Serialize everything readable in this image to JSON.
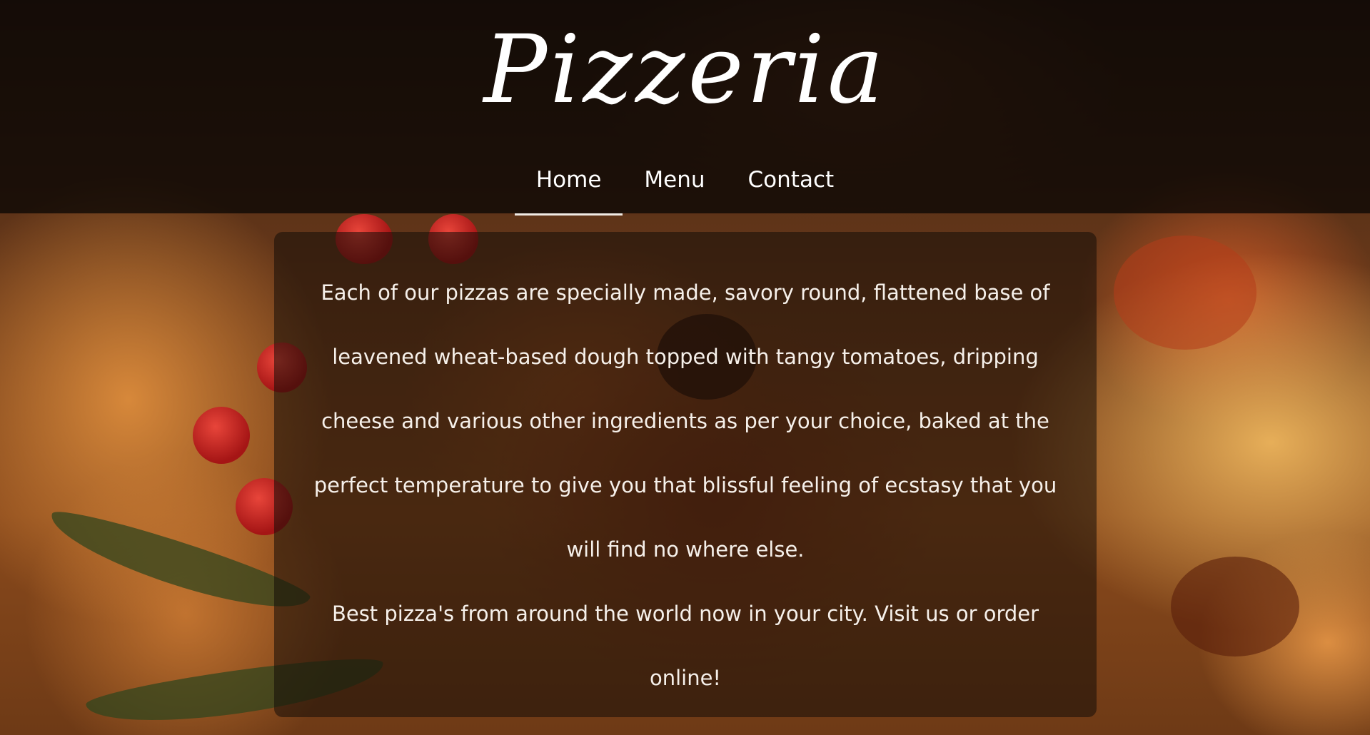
{
  "brand": {
    "title": "Pizzeria"
  },
  "nav": {
    "items": [
      {
        "label": "Home",
        "active": true
      },
      {
        "label": "Menu",
        "active": false
      },
      {
        "label": "Contact",
        "active": false
      }
    ]
  },
  "content": {
    "paragraph_1": "Each of our pizzas are specially made, savory round, flattened base of leavened wheat-based dough topped with tangy tomatoes, dripping cheese and various other ingredients as per your choice, baked at the perfect temperature to give you that blissful feeling of ecstasy that you will find no where else.",
    "paragraph_2": "Best pizza's from around the world now in your city. Visit us or order online!"
  },
  "colors": {
    "header_overlay": "#0a0604",
    "nav_underline": "#f0eae4",
    "text": "#ffffff"
  },
  "icons": {
    "background": "pizza-photo"
  }
}
